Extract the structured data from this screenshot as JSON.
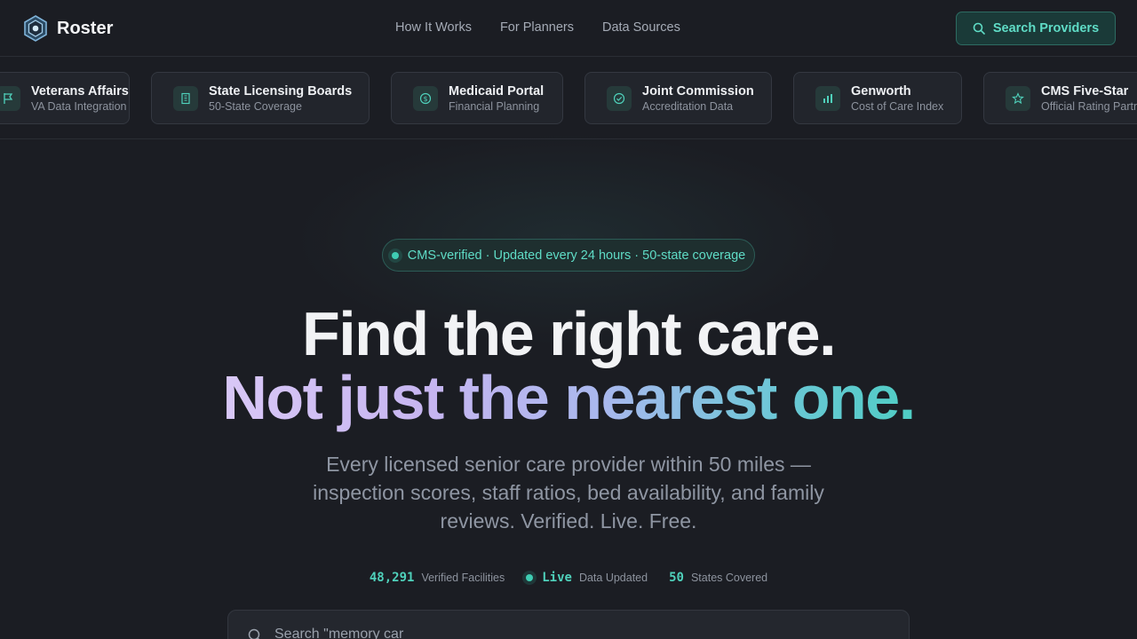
{
  "brand": {
    "name": "Roster"
  },
  "nav": {
    "items": [
      {
        "label": "How It Works"
      },
      {
        "label": "For Planners"
      },
      {
        "label": "Data Sources"
      }
    ],
    "cta_label": "Search Providers"
  },
  "partners": [
    {
      "title": "Veterans Affairs",
      "subtitle": "VA Data Integration",
      "icon": "flag-icon"
    },
    {
      "title": "State Licensing Boards",
      "subtitle": "50-State Coverage",
      "icon": "building-icon"
    },
    {
      "title": "Medicaid Portal",
      "subtitle": "Financial Planning",
      "icon": "dollar-icon"
    },
    {
      "title": "Joint Commission",
      "subtitle": "Accreditation Data",
      "icon": "check-circle-icon"
    },
    {
      "title": "Genworth",
      "subtitle": "Cost of Care Index",
      "icon": "bar-chart-icon"
    },
    {
      "title": "CMS Five-Star",
      "subtitle": "Official Rating Partner",
      "icon": "star-icon"
    }
  ],
  "hero": {
    "badge": "CMS-verified · Updated every 24 hours · 50-state coverage",
    "headline_1": "Find the right care.",
    "headline_2": "Not just the nearest one.",
    "subheadline": "Every licensed senior care provider within 50 miles — inspection scores, staff ratios, bed availability, and family reviews. Verified. Live. Free."
  },
  "stats": [
    {
      "value": "48,291",
      "label": "Verified Facilities"
    },
    {
      "value": "Live",
      "label": "Data Updated"
    },
    {
      "value": "50",
      "label": "States Covered"
    }
  ],
  "search": {
    "value": "Search \"memory car"
  },
  "colors": {
    "accent": "#4fd1bb",
    "background": "#1b1d23",
    "card": "#22252c"
  }
}
